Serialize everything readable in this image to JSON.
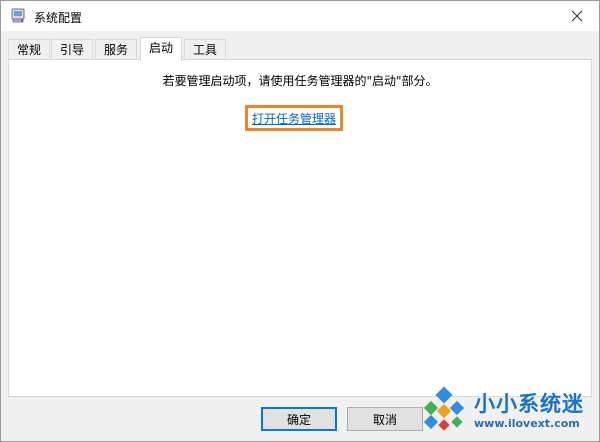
{
  "window": {
    "title": "系统配置",
    "icon": "msconfig-app-icon",
    "close_icon": "close-icon"
  },
  "tabs": [
    {
      "label": "常规",
      "active": false
    },
    {
      "label": "引导",
      "active": false
    },
    {
      "label": "服务",
      "active": false
    },
    {
      "label": "启动",
      "active": true
    },
    {
      "label": "工具",
      "active": false
    }
  ],
  "startup_panel": {
    "instruction": "若要管理启动项，请使用任务管理器的\"启动\"部分。",
    "open_task_manager_link": "打开任务管理器",
    "highlight_color": "#e8872b"
  },
  "footer": {
    "ok_label": "确定",
    "cancel_label": "取消"
  },
  "watermark": {
    "brand": "小小系统迷",
    "url": "www.ilovext.com"
  },
  "colors": {
    "link": "#0066cc",
    "primary_border": "#0078d7",
    "brand": "#1a73c8"
  }
}
